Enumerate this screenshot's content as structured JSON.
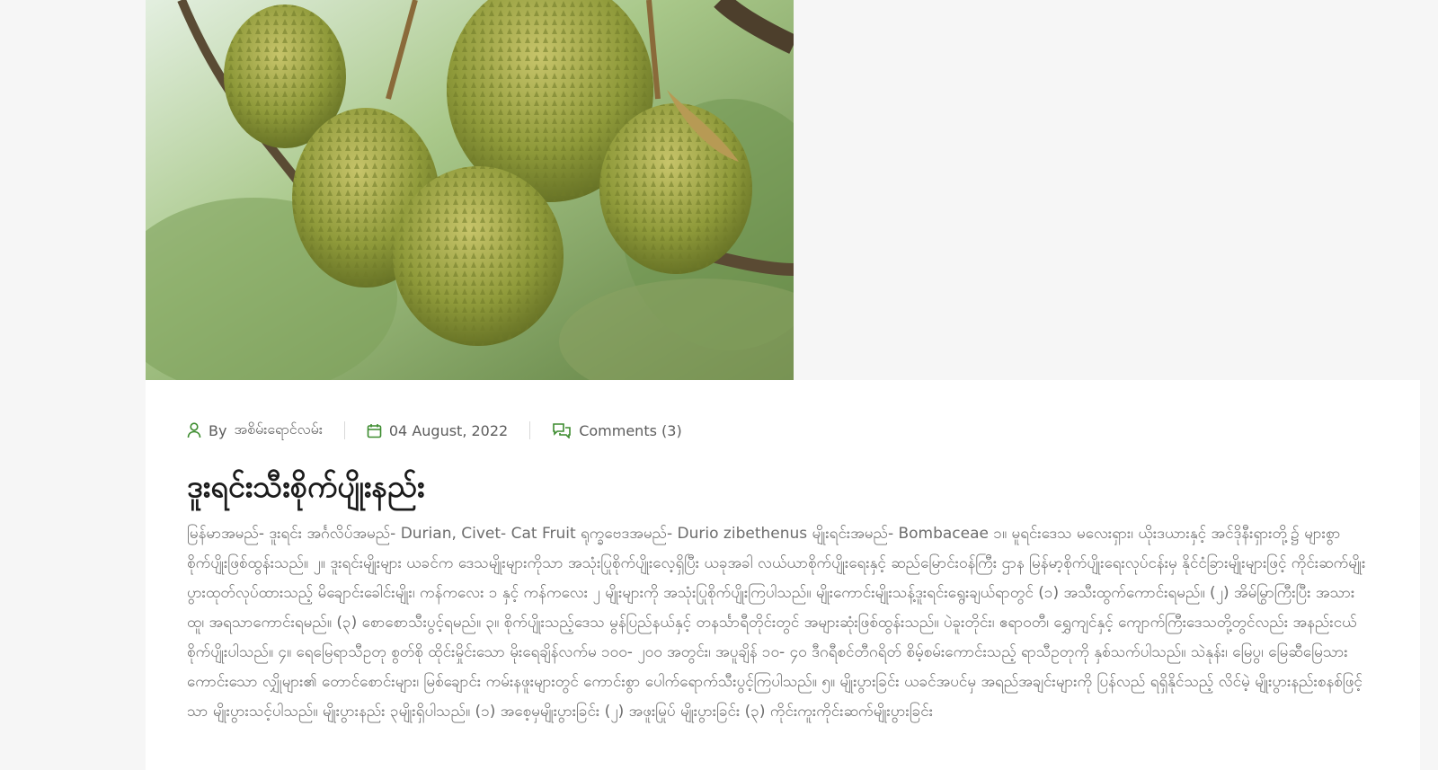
{
  "post": {
    "author_prefix": "By",
    "author": "အစိမ်းရောင်လမ်း",
    "date": "04 August, 2022",
    "comments": "Comments (3)",
    "title": "ဒူးရင်းသီးစိုက်ပျိုးနည်း",
    "body": "မြန်မာအမည်- ဒူးရင်း အင်္ဂလိပ်အမည်- Durian, Civet- Cat Fruit ရုက္ခဗေဒအမည်- Durio zibethenus မျိုးရင်းအမည်- Bombaceae ၁။ မူရင်းဒေသ မလေးရှား၊ ယိုးဒယားနှင့် အင်ဒိုနီးရှားတို့၌ များစွာစိုက်ပျိုးဖြစ်ထွန်းသည်။ ၂။ ဒူးရင်းမျိုးများ ယခင်က ဒေသမျိုးများကိုသာ အသုံးပြုစိုက်ပျိုးလေ့ရှိပြီး ယခုအခါ လယ်ယာစိုက်ပျိုးရေးနှင့် ဆည်မြောင်းဝန်ကြီး ဌာန မြန်မာ့စိုက်ပျိုးရေးလုပ်ငန်းမှ နိုင်ငံခြားမျိုးများဖြင့် ကိုင်းဆက်မျိုးပွားထုတ်လုပ်ထားသည့် မိချောင်းခေါင်းမျိုး၊ ကန်ကလေး ၁ နှင့် ကန်ကလေး ၂ မျိုးများကို အသုံးပြုစိုက်ပျိုးကြပါသည်။ မျိုးကောင်းမျိုးသန့်ဒူးရင်းရွေးချယ်ရာတွင် (၁) အသီးထွက်ကောင်းရမည်။ (၂) အိမ်မြွာကြီးပြီး အသားထူ၊ အရသာကောင်းရမည်။ (၃) စောစောသီးပွင့်ရမည်။ ၃။ စိုက်ပျိုးသည့်ဒေသ မွန်ပြည်နယ်နှင့် တနင်္သာရီတိုင်းတွင် အများဆုံးဖြစ်ထွန်းသည်။ ပဲခူးတိုင်း၊ ဧရာဝတီ၊ ရွှေကျင်နှင့် ကျောက်ကြီးဒေသတို့တွင်လည်း အနည်းငယ်စိုက်ပျိုးပါသည်။ ၄။ ရေမြေရာသီဥတု စွတ်စို ထိုင်းမှိုင်းသော မိုးရေချိန်လက်မ ၁၀၀- ၂၀၀ အတွင်း၊ အပူချိန် ၁၀- ၄၀ ဒီဂရီစင်တီဂရိတ် စိမ့်စမ်းကောင်းသည့် ရာသီဥတုကို နှစ်သက်ပါသည်။ သဲနုန်း၊ မြေပွ၊ မြေဆီမြေသား ကောင်းသော လျှိုများ၏ တောင်စောင်းများ၊ မြစ်ချောင်း ကမ်းနဖူးများတွင် ကောင်းစွာ ပေါက်ရောက်သီးပွင့်ကြပါသည်။ ၅။ မျိုးပွားခြင်း ယခင်အပင်မှ အရည်အချင်းများကို ပြန်လည် ရရှိနိုင်သည့် လိင်မဲ့ မျိုးပွားနည်းစနစ်ဖြင့်သာ မျိုးပွားသင့်ပါသည်။ မျိုးပွားနည်း ၃မျိုးရှိပါသည်။ (၁) အစေ့မှမျိုးပွားခြင်း (၂) အဖူးမြုပ် မျိုးပွားခြင်း (၃) ကိုင်းကူးကိုင်းဆက်မျိုးပွားခြင်း"
  },
  "colors": {
    "accent": "#3d8c2f",
    "title": "#1b1b1b",
    "text": "#6d6d6d",
    "page_bg": "#f6f6f6",
    "card_bg": "#ffffff"
  },
  "icons": {
    "author": "user-icon",
    "date": "calendar-icon",
    "comments": "comments-icon"
  }
}
